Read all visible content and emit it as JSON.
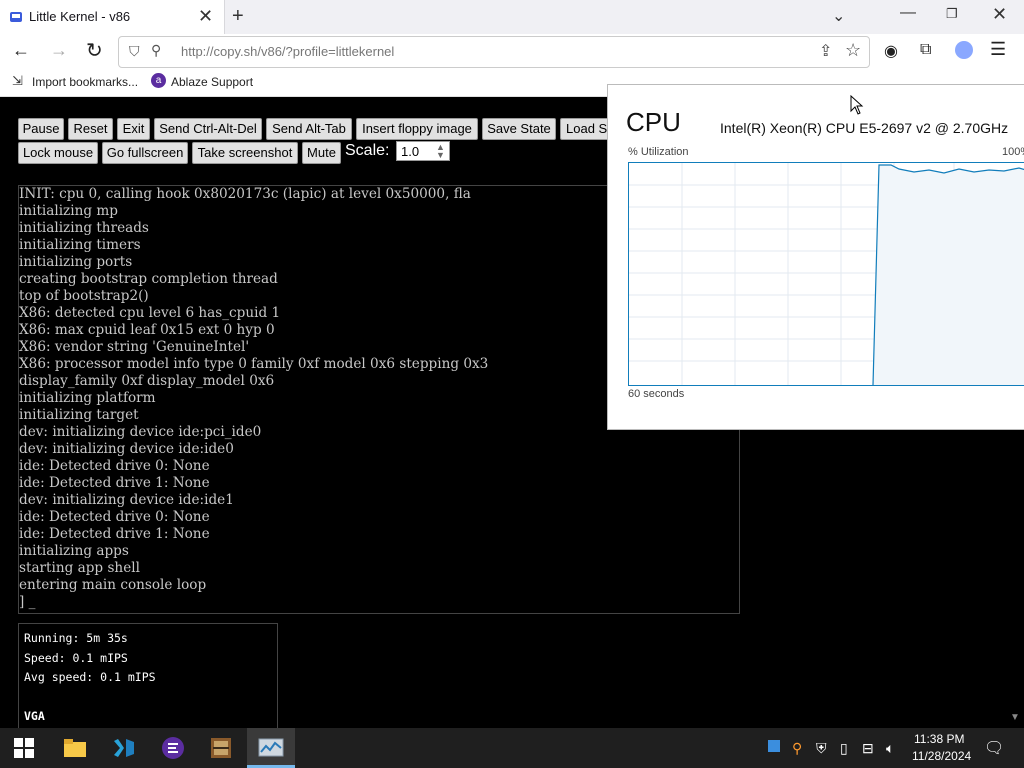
{
  "browser": {
    "tab_title": "Little Kernel - v86",
    "url": "http://copy.sh/v86/?profile=littlekernel",
    "bookmarks": [
      "Import bookmarks...",
      "Ablaze Support"
    ]
  },
  "toolbar": {
    "row1": [
      "Pause",
      "Reset",
      "Exit",
      "Send Ctrl-Alt-Del",
      "Send Alt-Tab",
      "Insert floppy image",
      "Save State",
      "Load St"
    ],
    "row2": [
      "Lock mouse",
      "Go fullscreen",
      "Take screenshot",
      "Mute"
    ],
    "scale_label": "Scale:",
    "scale_value": "1.0"
  },
  "console_lines": [
    "INIT: cpu 0, calling hook 0x8020173c (lapic) at level 0x50000, fla",
    "initializing mp",
    "initializing threads",
    "initializing timers",
    "initializing ports",
    "creating bootstrap completion thread",
    "top of bootstrap2()",
    "X86: detected cpu level 6 has_cpuid 1",
    "X86: max cpuid leaf 0x15 ext 0 hyp 0",
    "X86: vendor string 'GenuineIntel'",
    "X86: processor model info type 0 family 0xf model 0x6 stepping 0x3",
    "display_family 0xf display_model 0x6",
    "initializing platform",
    "initializing target",
    "dev: initializing device ide:pci_ide0",
    "dev: initializing device ide:ide0",
    "ide: Detected drive 0: None",
    "ide: Detected drive 1: None",
    "dev: initializing device ide:ide1",
    "ide: Detected drive 0: None",
    "ide: Detected drive 1: None",
    "initializing apps",
    "starting app shell",
    "entering main console loop",
    "] _"
  ],
  "stats": {
    "running": "Running: 5m 35s",
    "speed": "Speed: 0.1 mIPS",
    "avg_speed": "Avg speed: 0.1 mIPS",
    "vga": "VGA"
  },
  "task_manager": {
    "title": "CPU",
    "cpu_name": "Intel(R) Xeon(R) CPU E5-2697 v2 @ 2.70GHz",
    "util_label": "% Utilization",
    "max_label": "100%",
    "time_label": "60 seconds",
    "line_color": "#117dbb",
    "fill_color": "#f1f6fa"
  },
  "taskbar": {
    "time": "11:38 PM",
    "date": "11/28/2024",
    "apps": [
      "file-explorer-icon",
      "vscode-icon",
      "ablaze-browser-icon",
      "winrar-icon",
      "task-manager-icon"
    ]
  }
}
